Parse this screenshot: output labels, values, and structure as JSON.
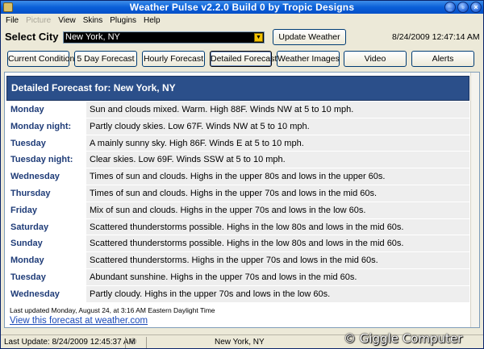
{
  "window": {
    "title": "Weather Pulse v2.2.0 Build 0 by Tropic Designs"
  },
  "menu": [
    "File",
    "Picture",
    "View",
    "Skins",
    "Plugins",
    "Help"
  ],
  "city": {
    "label": "Select City",
    "value": "New York, NY"
  },
  "update_button": "Update Weather",
  "datetime": "8/24/2009 12:47:14 AM",
  "nav": {
    "current": "Current Conditions",
    "five_day": "5 Day Forecast",
    "hourly": "Hourly Forecast",
    "detailed": "Detailed Forecast",
    "images": "Weather Images",
    "video": "Video",
    "alerts": "Alerts"
  },
  "forecast": {
    "header": "Detailed Forecast for: New York, NY",
    "rows": [
      {
        "day": "Monday",
        "text": "Sun and clouds mixed. Warm. High 88F. Winds NW at 5 to 10 mph."
      },
      {
        "day": "Monday night:",
        "text": "Partly cloudy skies. Low 67F. Winds NW at 5 to 10 mph."
      },
      {
        "day": "Tuesday",
        "text": "A mainly sunny sky. High 86F. Winds E at 5 to 10 mph."
      },
      {
        "day": "Tuesday night:",
        "text": "Clear skies. Low 69F. Winds SSW at 5 to 10 mph."
      },
      {
        "day": "Wednesday",
        "text": "Times of sun and clouds. Highs in the upper 80s and lows in the upper 60s."
      },
      {
        "day": "Thursday",
        "text": "Times of sun and clouds. Highs in the upper 70s and lows in the mid 60s."
      },
      {
        "day": "Friday",
        "text": "Mix of sun and clouds. Highs in the upper 70s and lows in the low 60s."
      },
      {
        "day": "Saturday",
        "text": "Scattered thunderstorms possible. Highs in the low 80s and lows in the mid 60s."
      },
      {
        "day": "Sunday",
        "text": "Scattered thunderstorms possible. Highs in the low 80s and lows in the mid 60s."
      },
      {
        "day": "Monday",
        "text": "Scattered thunderstorms. Highs in the upper 70s and lows in the mid 60s."
      },
      {
        "day": "Tuesday",
        "text": "Abundant sunshine. Highs in the upper 70s and lows in the mid 60s."
      },
      {
        "day": "Wednesday",
        "text": "Partly cloudy. Highs in the upper 70s and lows in the low 60s."
      }
    ],
    "last_updated": "Last updated Monday, August 24, at 3:16 AM Eastern Daylight Time",
    "link": "View this forecast at weather.com"
  },
  "status": {
    "last_update": "Last Update: 8/24/2009 12:45:37 AM",
    "city": "New York, NY"
  },
  "watermark": "© Giggle Computer"
}
